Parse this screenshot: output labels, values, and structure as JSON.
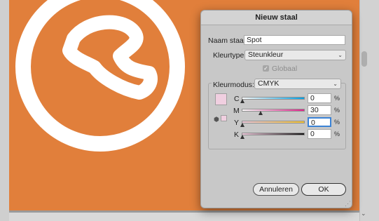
{
  "dialog": {
    "title": "Nieuw staal",
    "name_label": "Naam staal:",
    "name_value": "Spot",
    "colortype_label": "Kleurtype:",
    "colortype_value": "Steunkleur",
    "global_label": "Globaal",
    "colormode_label": "Kleurmodus:",
    "colormode_value": "CMYK",
    "swatch_color": "#f0cfe0",
    "channels": [
      {
        "label": "C",
        "value": "0",
        "level": 0
      },
      {
        "label": "M",
        "value": "30",
        "level": 30
      },
      {
        "label": "Y",
        "value": "0",
        "level": 0
      },
      {
        "label": "K",
        "value": "0",
        "level": 0
      }
    ],
    "percent_sign": "%",
    "cancel_label": "Annuleren",
    "ok_label": "OK"
  },
  "colors": {
    "artboard": "#e17f3b",
    "swatch": "#f0cfe0"
  }
}
